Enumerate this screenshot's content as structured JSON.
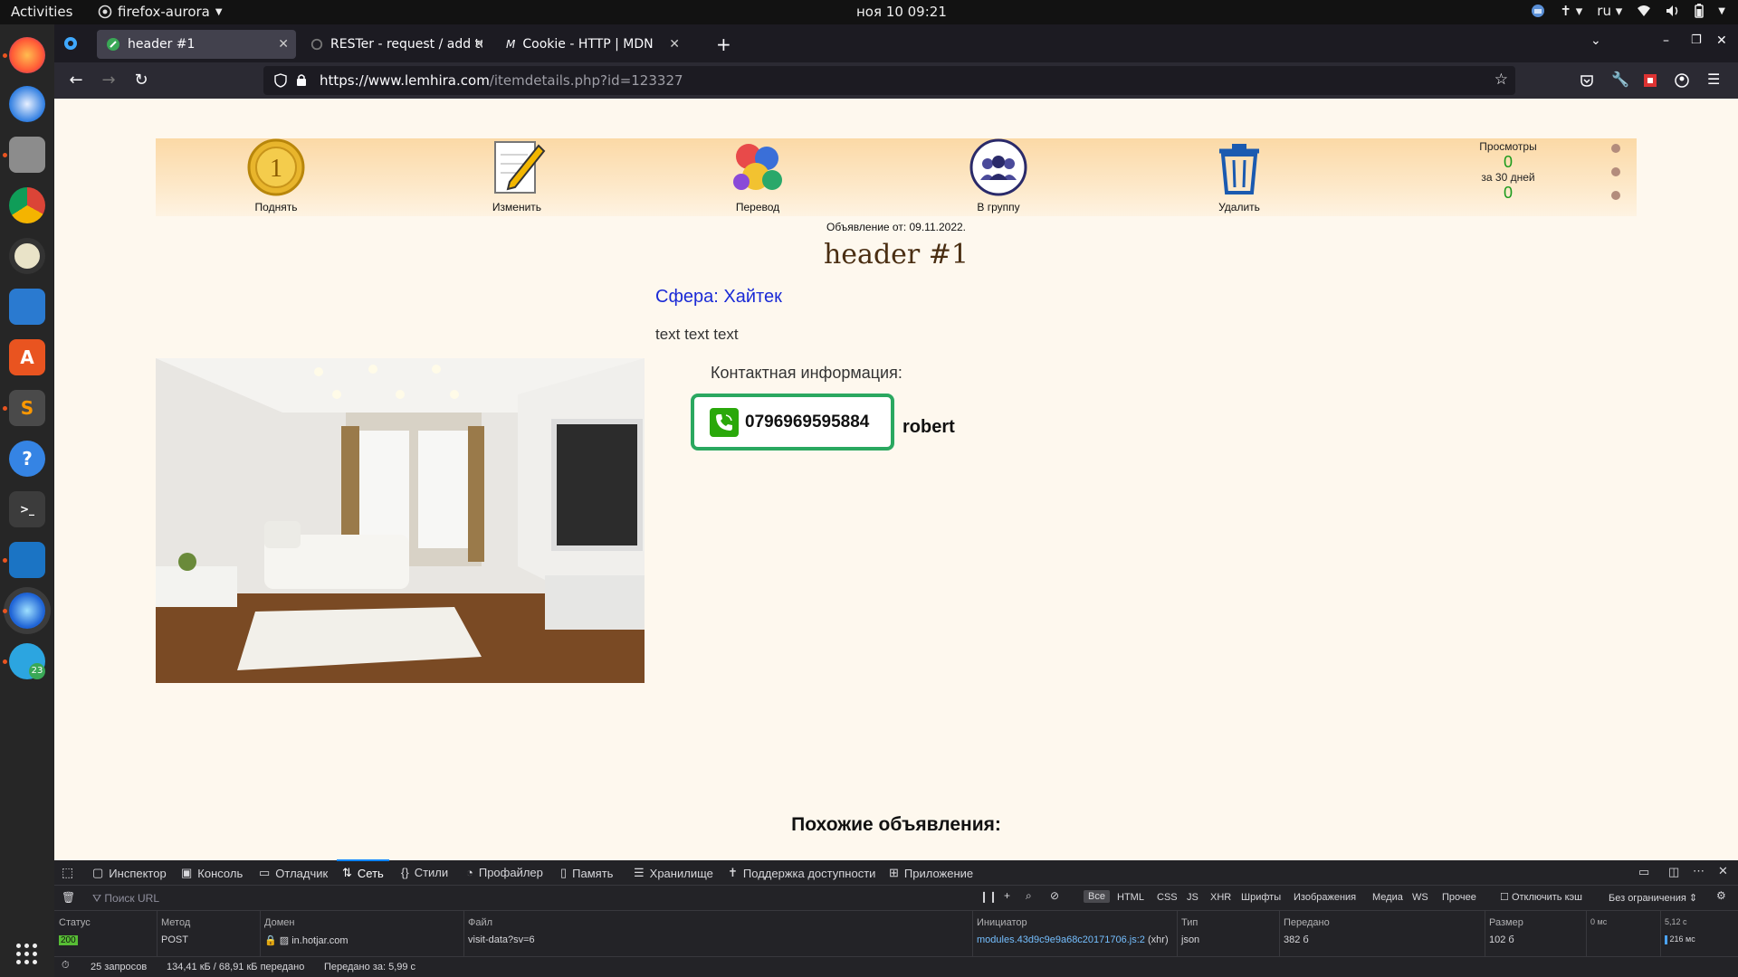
{
  "topbar": {
    "activities": "Activities",
    "app_name": "firefox-aurora",
    "clock": "ноя 10  09:21",
    "lang": "ru"
  },
  "tabs": [
    {
      "title": "header #1"
    },
    {
      "title": "RESTer - request / add to"
    },
    {
      "title": "Cookie - HTTP | MDN"
    }
  ],
  "url": {
    "host": "https://www.lemhira.com",
    "path": "/itemdetails.php?id=123327"
  },
  "actions": [
    {
      "label": "Поднять"
    },
    {
      "label": "Изменить"
    },
    {
      "label": "Перевод"
    },
    {
      "label": "В группу"
    },
    {
      "label": "Удалить"
    }
  ],
  "views": {
    "label": "Просмотры",
    "total": "0",
    "period_label": "за 30 дней",
    "period": "0"
  },
  "post": {
    "date": "Объявление от: 09.11.2022.",
    "title": "header #1",
    "sphere": "Сфера: Хайтек",
    "description": "text text text",
    "contact_label": "Контактная информация:",
    "phone": "0796969595884",
    "owner": "robert",
    "similar_heading": "Похожие объявления:"
  },
  "devtools": {
    "tabs": [
      "Инспектор",
      "Консоль",
      "Отладчик",
      "Сеть",
      "Стили",
      "Профайлер",
      "Память",
      "Хранилище",
      "Поддержка доступности",
      "Приложение"
    ],
    "filter_placeholder": "Поиск URL",
    "types": [
      "Все",
      "HTML",
      "CSS",
      "JS",
      "XHR",
      "Шрифты",
      "Изображения",
      "Медиа",
      "WS",
      "Прочее"
    ],
    "disable_cache": "Отключить кэш",
    "throttle": "Без ограничения ⇕",
    "columns": [
      "Статус",
      "Метод",
      "Домен",
      "Файл",
      "Инициатор",
      "Тип",
      "Передано",
      "Размер",
      "0 мс",
      "5,12 с"
    ],
    "row": {
      "status": "200",
      "method": "POST",
      "domain": "in.hotjar.com",
      "file": "visit-data?sv=6",
      "initiator": "modules.43d9c9e9a68c20171706.js:2",
      "initiator_suffix": "(xhr)",
      "type": "json",
      "transferred": "382 б",
      "size": "102 б",
      "timing": "216 мс"
    },
    "summary": {
      "requests": "25 запросов",
      "transferred": "134,41 кБ / 68,91 кБ передано",
      "finish": "Передано за: 5,99 с"
    }
  },
  "dock": {
    "telegram_badge": "23"
  },
  "colors": {
    "page_bg": "#fef8ee",
    "sphere_link": "#1a2ad6",
    "phone_border": "#2aa860",
    "views_number": "#1a9a1a"
  }
}
